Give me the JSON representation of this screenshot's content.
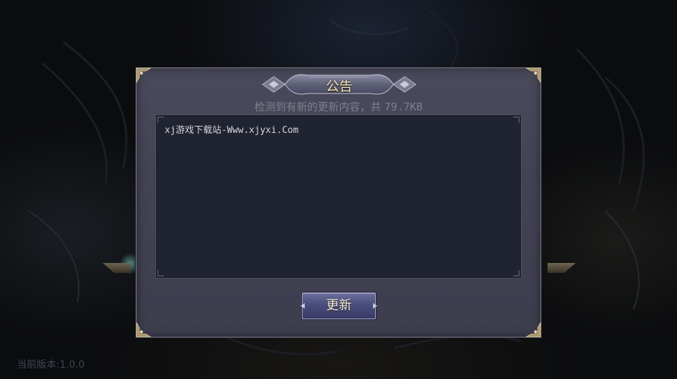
{
  "dialog": {
    "title": "公告",
    "subtitle_prefix": "检测到有新的更新内容，共 ",
    "subtitle_size": "79.7KB",
    "content": "xj游戏下载站-Www.xjyxi.Com",
    "update_button_label": "更新"
  },
  "footer": {
    "version_label": "当前版本:1.0.0"
  },
  "colors": {
    "dialog_bg": "#434355",
    "title_text": "#f1e6c2",
    "subtitle_text": "#7f7f8f",
    "content_bg": "#202430",
    "button_bg": "#4a4d7c",
    "version_text": "#3f4656"
  }
}
